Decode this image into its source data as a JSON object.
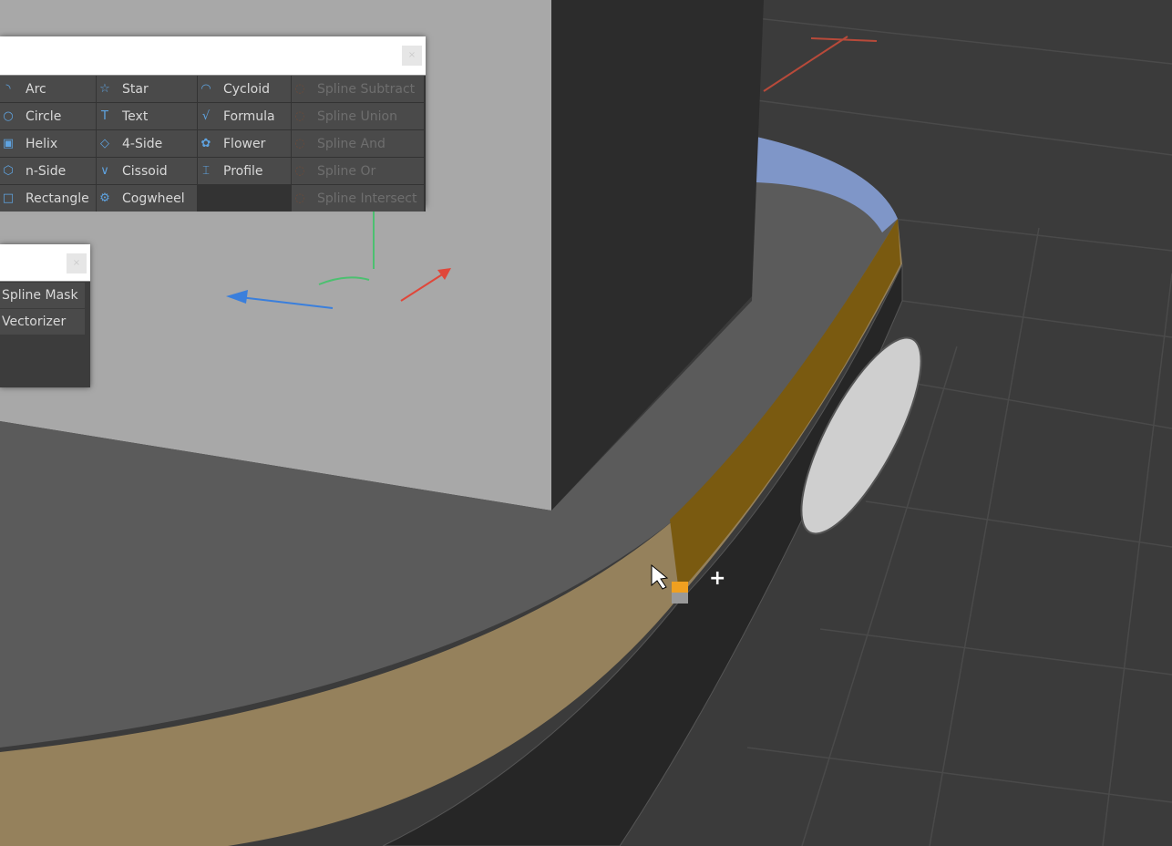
{
  "colors": {
    "selection": "#e8a030",
    "accent": "#5fa3e0",
    "viewport_bg": "#3b3b3b"
  },
  "spline_palette": {
    "close_icon": "close-icon",
    "items": [
      {
        "label": "Arc",
        "icon": "arc-icon",
        "enabled": true
      },
      {
        "label": "Star",
        "icon": "star-icon",
        "enabled": true
      },
      {
        "label": "Cycloid",
        "icon": "cycloid-icon",
        "enabled": true
      },
      {
        "label": "Spline Subtract",
        "icon": "spline-subtract-icon",
        "enabled": false
      },
      {
        "label": "Circle",
        "icon": "circle-icon",
        "enabled": true
      },
      {
        "label": "Text",
        "icon": "text-icon",
        "enabled": true
      },
      {
        "label": "Formula",
        "icon": "formula-icon",
        "enabled": true
      },
      {
        "label": "Spline Union",
        "icon": "spline-union-icon",
        "enabled": false
      },
      {
        "label": "Helix",
        "icon": "helix-icon",
        "enabled": true
      },
      {
        "label": "4-Side",
        "icon": "four-side-icon",
        "enabled": true
      },
      {
        "label": "Flower",
        "icon": "flower-icon",
        "enabled": true
      },
      {
        "label": "Spline And",
        "icon": "spline-and-icon",
        "enabled": false
      },
      {
        "label": "n-Side",
        "icon": "n-side-icon",
        "enabled": true
      },
      {
        "label": "Cissoid",
        "icon": "cissoid-icon",
        "enabled": true
      },
      {
        "label": "Profile",
        "icon": "profile-icon",
        "enabled": true
      },
      {
        "label": "Spline Or",
        "icon": "spline-or-icon",
        "enabled": false
      },
      {
        "label": "Rectangle",
        "icon": "rectangle-icon",
        "enabled": true
      },
      {
        "label": "Cogwheel",
        "icon": "cogwheel-icon",
        "enabled": true
      },
      {
        "label": "",
        "icon": "",
        "enabled": false
      },
      {
        "label": "Spline Intersect",
        "icon": "spline-intersect-icon",
        "enabled": false
      }
    ]
  },
  "generator_palette": {
    "items": [
      {
        "label": "Spline Mask"
      },
      {
        "label": "Vectorizer"
      }
    ]
  }
}
